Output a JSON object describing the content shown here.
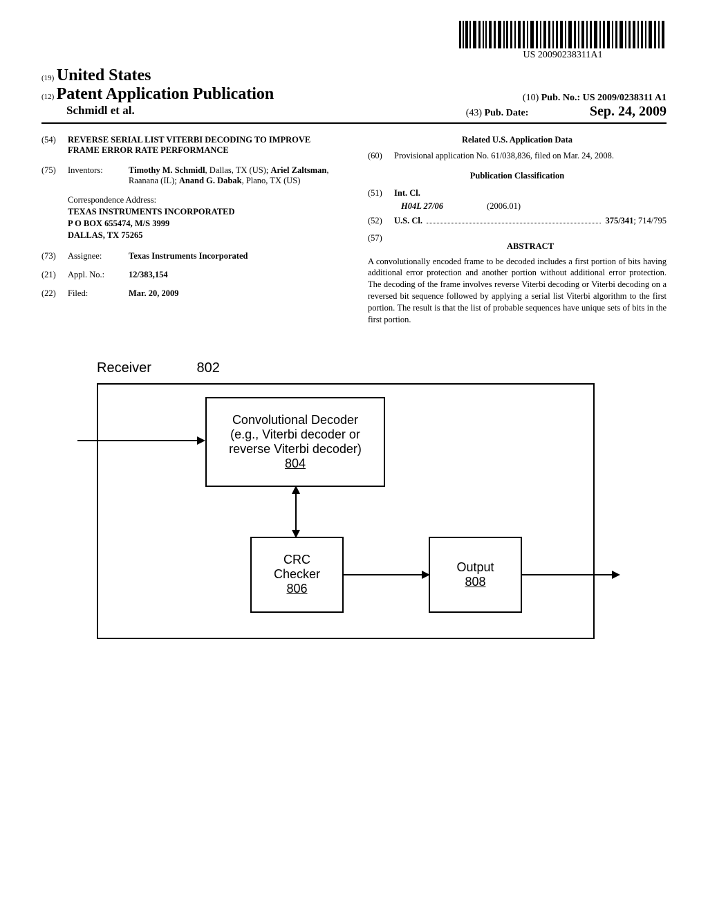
{
  "barcode_text": "US 20090238311A1",
  "header": {
    "country_code": "(19)",
    "country_name": "United States",
    "pub_code": "(12)",
    "pub_title": "Patent Application Publication",
    "pub_no_code": "(10)",
    "pub_no_label": "Pub. No.:",
    "pub_no_value": "US 2009/0238311 A1",
    "authors": "Schmidl et al.",
    "pub_date_code": "(43)",
    "pub_date_label": "Pub. Date:",
    "pub_date_value": "Sep. 24, 2009"
  },
  "left_col": {
    "title_num": "(54)",
    "title_text": "REVERSE SERIAL LIST VITERBI DECODING TO IMPROVE FRAME ERROR RATE PERFORMANCE",
    "inventors_num": "(75)",
    "inventors_label": "Inventors:",
    "inventors_value_1": "Timothy M. Schmidl",
    "inventors_value_1b": ", Dallas, TX (US); ",
    "inventors_value_2": "Ariel Zaltsman",
    "inventors_value_2b": ", Raanana (IL); ",
    "inventors_value_3": "Anand G. Dabak",
    "inventors_value_3b": ", Plano, TX (US)",
    "corr_label": "Correspondence Address:",
    "corr_line1": "TEXAS INSTRUMENTS INCORPORATED",
    "corr_line2": "P O BOX 655474, M/S 3999",
    "corr_line3": "DALLAS, TX 75265",
    "assignee_num": "(73)",
    "assignee_label": "Assignee:",
    "assignee_value": "Texas Instruments Incorporated",
    "appl_num": "(21)",
    "appl_label": "Appl. No.:",
    "appl_value": "12/383,154",
    "filed_num": "(22)",
    "filed_label": "Filed:",
    "filed_value": "Mar. 20, 2009"
  },
  "right_col": {
    "rel_header": "Related U.S. Application Data",
    "prov_num": "(60)",
    "prov_text": "Provisional application No. 61/038,836, filed on Mar. 24, 2008.",
    "pub_class_header": "Publication Classification",
    "int_cl_num": "(51)",
    "int_cl_label": "Int. Cl.",
    "int_cl_value": "H04L 27/06",
    "int_cl_year": "(2006.01)",
    "us_cl_num": "(52)",
    "us_cl_label": "U.S. Cl.",
    "us_cl_value1": "375/341",
    "us_cl_value2": "; 714/795",
    "abstract_num": "(57)",
    "abstract_label": "ABSTRACT",
    "abstract_text": "A convolutionally encoded frame to be decoded includes a first portion of bits having additional error protection and another portion without additional error protection. The decoding of the frame involves reverse Viterbi decoding or Viterbi decoding on a reversed bit sequence followed by applying a serial list Viterbi algorithm to the first portion. The result is that the list of probable sequences have unique sets of bits in the first portion."
  },
  "diagram": {
    "receiver_label": "Receiver",
    "receiver_num": "802",
    "decoder_line1": "Convolutional Decoder",
    "decoder_line2": "(e.g., Viterbi decoder or",
    "decoder_line3": "reverse Viterbi decoder)",
    "decoder_num": "804",
    "crc_line1": "CRC",
    "crc_line2": "Checker",
    "crc_num": "806",
    "output_label": "Output",
    "output_num": "808"
  }
}
